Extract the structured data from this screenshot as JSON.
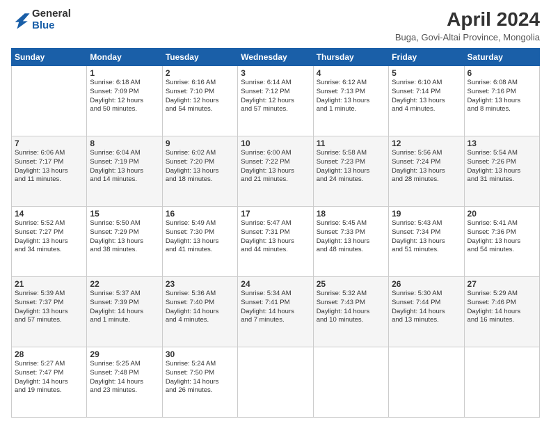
{
  "logo": {
    "general": "General",
    "blue": "Blue"
  },
  "title": "April 2024",
  "subtitle": "Buga, Govi-Altai Province, Mongolia",
  "weekdays": [
    "Sunday",
    "Monday",
    "Tuesday",
    "Wednesday",
    "Thursday",
    "Friday",
    "Saturday"
  ],
  "weeks": [
    [
      {
        "day": "",
        "info": ""
      },
      {
        "day": "1",
        "info": "Sunrise: 6:18 AM\nSunset: 7:09 PM\nDaylight: 12 hours\nand 50 minutes."
      },
      {
        "day": "2",
        "info": "Sunrise: 6:16 AM\nSunset: 7:10 PM\nDaylight: 12 hours\nand 54 minutes."
      },
      {
        "day": "3",
        "info": "Sunrise: 6:14 AM\nSunset: 7:12 PM\nDaylight: 12 hours\nand 57 minutes."
      },
      {
        "day": "4",
        "info": "Sunrise: 6:12 AM\nSunset: 7:13 PM\nDaylight: 13 hours\nand 1 minute."
      },
      {
        "day": "5",
        "info": "Sunrise: 6:10 AM\nSunset: 7:14 PM\nDaylight: 13 hours\nand 4 minutes."
      },
      {
        "day": "6",
        "info": "Sunrise: 6:08 AM\nSunset: 7:16 PM\nDaylight: 13 hours\nand 8 minutes."
      }
    ],
    [
      {
        "day": "7",
        "info": "Sunrise: 6:06 AM\nSunset: 7:17 PM\nDaylight: 13 hours\nand 11 minutes."
      },
      {
        "day": "8",
        "info": "Sunrise: 6:04 AM\nSunset: 7:19 PM\nDaylight: 13 hours\nand 14 minutes."
      },
      {
        "day": "9",
        "info": "Sunrise: 6:02 AM\nSunset: 7:20 PM\nDaylight: 13 hours\nand 18 minutes."
      },
      {
        "day": "10",
        "info": "Sunrise: 6:00 AM\nSunset: 7:22 PM\nDaylight: 13 hours\nand 21 minutes."
      },
      {
        "day": "11",
        "info": "Sunrise: 5:58 AM\nSunset: 7:23 PM\nDaylight: 13 hours\nand 24 minutes."
      },
      {
        "day": "12",
        "info": "Sunrise: 5:56 AM\nSunset: 7:24 PM\nDaylight: 13 hours\nand 28 minutes."
      },
      {
        "day": "13",
        "info": "Sunrise: 5:54 AM\nSunset: 7:26 PM\nDaylight: 13 hours\nand 31 minutes."
      }
    ],
    [
      {
        "day": "14",
        "info": "Sunrise: 5:52 AM\nSunset: 7:27 PM\nDaylight: 13 hours\nand 34 minutes."
      },
      {
        "day": "15",
        "info": "Sunrise: 5:50 AM\nSunset: 7:29 PM\nDaylight: 13 hours\nand 38 minutes."
      },
      {
        "day": "16",
        "info": "Sunrise: 5:49 AM\nSunset: 7:30 PM\nDaylight: 13 hours\nand 41 minutes."
      },
      {
        "day": "17",
        "info": "Sunrise: 5:47 AM\nSunset: 7:31 PM\nDaylight: 13 hours\nand 44 minutes."
      },
      {
        "day": "18",
        "info": "Sunrise: 5:45 AM\nSunset: 7:33 PM\nDaylight: 13 hours\nand 48 minutes."
      },
      {
        "day": "19",
        "info": "Sunrise: 5:43 AM\nSunset: 7:34 PM\nDaylight: 13 hours\nand 51 minutes."
      },
      {
        "day": "20",
        "info": "Sunrise: 5:41 AM\nSunset: 7:36 PM\nDaylight: 13 hours\nand 54 minutes."
      }
    ],
    [
      {
        "day": "21",
        "info": "Sunrise: 5:39 AM\nSunset: 7:37 PM\nDaylight: 13 hours\nand 57 minutes."
      },
      {
        "day": "22",
        "info": "Sunrise: 5:37 AM\nSunset: 7:39 PM\nDaylight: 14 hours\nand 1 minute."
      },
      {
        "day": "23",
        "info": "Sunrise: 5:36 AM\nSunset: 7:40 PM\nDaylight: 14 hours\nand 4 minutes."
      },
      {
        "day": "24",
        "info": "Sunrise: 5:34 AM\nSunset: 7:41 PM\nDaylight: 14 hours\nand 7 minutes."
      },
      {
        "day": "25",
        "info": "Sunrise: 5:32 AM\nSunset: 7:43 PM\nDaylight: 14 hours\nand 10 minutes."
      },
      {
        "day": "26",
        "info": "Sunrise: 5:30 AM\nSunset: 7:44 PM\nDaylight: 14 hours\nand 13 minutes."
      },
      {
        "day": "27",
        "info": "Sunrise: 5:29 AM\nSunset: 7:46 PM\nDaylight: 14 hours\nand 16 minutes."
      }
    ],
    [
      {
        "day": "28",
        "info": "Sunrise: 5:27 AM\nSunset: 7:47 PM\nDaylight: 14 hours\nand 19 minutes."
      },
      {
        "day": "29",
        "info": "Sunrise: 5:25 AM\nSunset: 7:48 PM\nDaylight: 14 hours\nand 23 minutes."
      },
      {
        "day": "30",
        "info": "Sunrise: 5:24 AM\nSunset: 7:50 PM\nDaylight: 14 hours\nand 26 minutes."
      },
      {
        "day": "",
        "info": ""
      },
      {
        "day": "",
        "info": ""
      },
      {
        "day": "",
        "info": ""
      },
      {
        "day": "",
        "info": ""
      }
    ]
  ]
}
